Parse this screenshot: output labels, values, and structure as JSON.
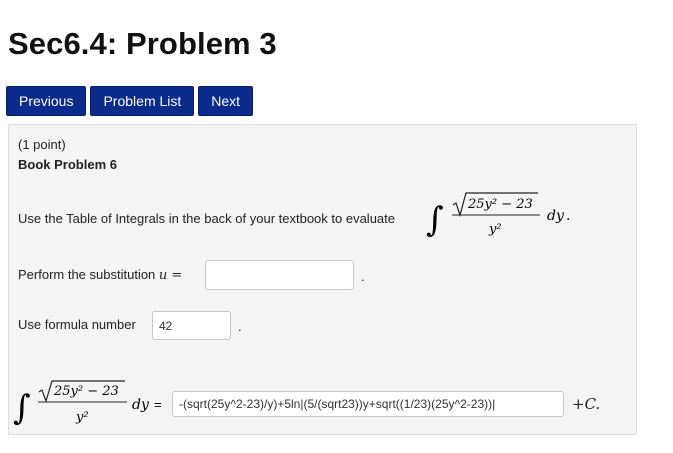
{
  "page": {
    "title": "Sec6.4: Problem 3"
  },
  "nav": {
    "previous": "Previous",
    "problem_list": "Problem List",
    "next": "Next"
  },
  "problem": {
    "points": "(1 point)",
    "book": "Book Problem 6",
    "evaluate_text": "Use the Table of Integrals in the back of your textbook to evaluate",
    "substitution_text": "Perform the substitution",
    "substitution_var": "u =",
    "substitution_value": "",
    "formula_text": "Use formula number",
    "formula_value": "42",
    "answer_value": "-(sqrt(25y^2-23)/y)+5ln|(5/(sqrt23))y+sqrt((1/23)(25y^2-23))|",
    "plus_c": "+C.",
    "math": {
      "integral_sign": "∫",
      "numerator_radicand": "25y² − 23",
      "denominator": "y²",
      "differential": "dy",
      "equals": "="
    }
  },
  "colors": {
    "button_bg": "#0a2a8c",
    "panel_bg": "#f4f4f4"
  }
}
